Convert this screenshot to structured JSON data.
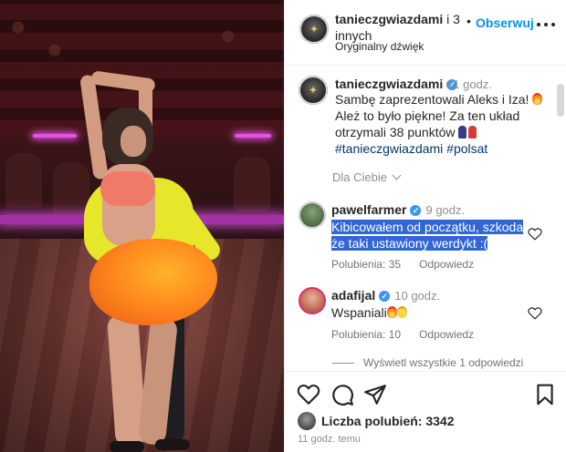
{
  "post": {
    "username": "tanieczgwiazdami",
    "coauthors": "i 3 innych",
    "dot": "•",
    "follow_label": "Obserwuj",
    "audio": "Oryginalny dźwięk"
  },
  "caption": {
    "username": "tanieczgwiazdami",
    "time": "11 godz.",
    "line1": "Sambę zaprezentowali Aleks i Iza! ",
    "line2": "Ależ to było piękne! Za ten układ otrzymali 38 punktów ",
    "hashtags": "#tanieczgwiazdami #polsat"
  },
  "for_you": "Dla Ciebie",
  "comments": [
    {
      "username": "pawelfarmer",
      "time": "9 godz.",
      "text": "Kibicowałem od początku, szkoda że taki ustawiony werdykt :(",
      "likes": "Polubienia: 35",
      "reply": "Odpowiedz"
    },
    {
      "username": "adafijal",
      "time": "10 godz.",
      "text": "Wspaniali",
      "likes": "Polubienia: 10",
      "reply": "Odpowiedz"
    }
  ],
  "see_replies": "Wyświetl wszystkie 1 odpowiedzi",
  "likes_total": "Liczba polubień: 3342",
  "posted_ago": "11 godz. temu",
  "icons": [
    "heart-icon",
    "comment-icon",
    "share-icon",
    "bookmark-icon",
    "more-icon",
    "verified-icon",
    "chevron-down-icon"
  ],
  "colors": {
    "accent": "#0095f6",
    "highlight": "#3166d6",
    "hashtag": "#00376b",
    "muted": "#8e8e8e"
  }
}
